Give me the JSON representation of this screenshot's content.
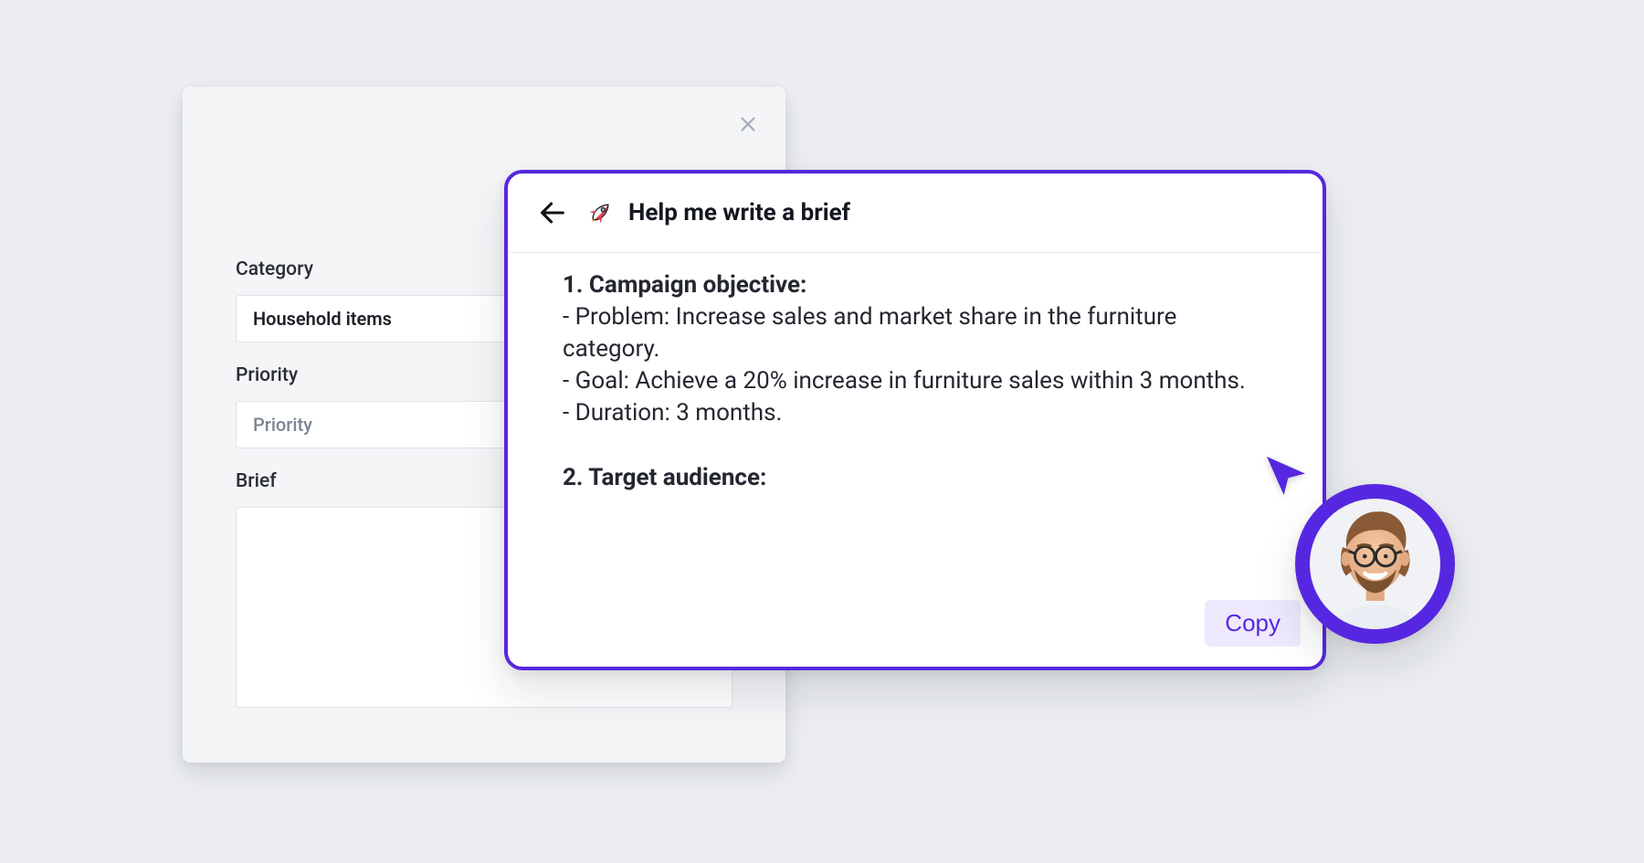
{
  "accent_color": "#5b2ce8",
  "form": {
    "close_icon_name": "close-icon",
    "fields": {
      "category": {
        "label": "Category",
        "value": "Household items"
      },
      "priority": {
        "label": "Priority",
        "placeholder": "Priority"
      },
      "brief": {
        "label": "Brief"
      }
    }
  },
  "ai_panel": {
    "title": "Help me write a brief",
    "icons": {
      "back": "back-arrow-icon",
      "rocket": "rocket-icon"
    },
    "copy_label": "Copy",
    "sections": [
      {
        "number": "1",
        "heading": "Campaign objective:",
        "bullets": [
          "- Problem: Increase sales and market share in the furniture category.",
          "- Goal: Achieve a 20% increase in furniture sales within 3 months.",
          "- Duration: 3 months."
        ]
      },
      {
        "number": "2",
        "heading": "Target audience:",
        "bullets": []
      }
    ]
  },
  "avatar": {
    "alt": "man-with-glasses-avatar"
  }
}
